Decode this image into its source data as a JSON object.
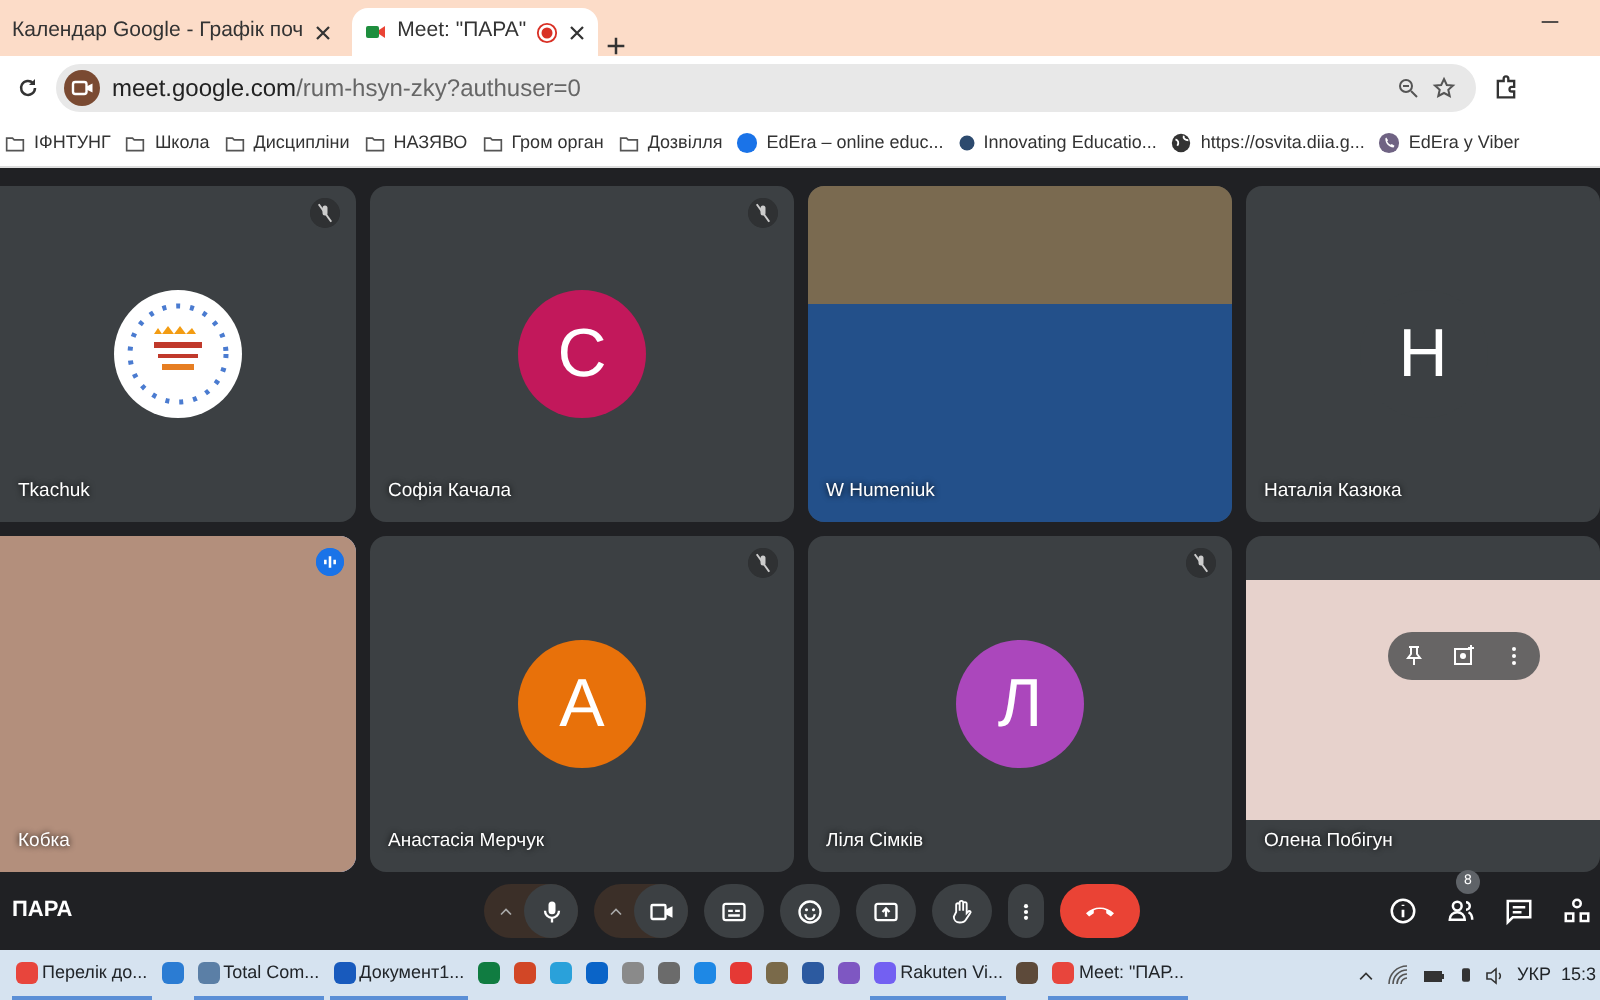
{
  "browser_tabs": [
    {
      "title": "Календар Google - Графік поч",
      "selected": false,
      "recording": false
    },
    {
      "title": "Meet: \"ПАРА\"",
      "selected": true,
      "recording": true
    }
  ],
  "address_bar": {
    "domain": "meet.google.com",
    "path": "/rum-hsyn-zky?authuser=0"
  },
  "bookmarks": [
    {
      "label": "ІФНТУНГ",
      "kind": "folder"
    },
    {
      "label": "Школа",
      "kind": "folder"
    },
    {
      "label": "Дисципліни",
      "kind": "folder"
    },
    {
      "label": "НАЗЯВО",
      "kind": "folder"
    },
    {
      "label": "Гром орган",
      "kind": "folder"
    },
    {
      "label": "Дозвілля",
      "kind": "folder"
    },
    {
      "label": "EdEra – online educ...",
      "kind": "site"
    },
    {
      "label": "Innovating Educatio...",
      "kind": "dot"
    },
    {
      "label": "https://osvita.diia.g...",
      "kind": "globe"
    },
    {
      "label": "EdEra у Viber",
      "kind": "viber"
    }
  ],
  "tiles": [
    {
      "name": "Tkachuk",
      "kind": "logo",
      "muted": true,
      "speaking": false,
      "hovered": false
    },
    {
      "name": "Софія Качала",
      "kind": "avatar",
      "initial": "С",
      "color": "#c2185b",
      "muted": true,
      "speaking": false,
      "hovered": false
    },
    {
      "name": "W Humeniuk",
      "kind": "video",
      "muted": false,
      "speaking": false,
      "hovered": false
    },
    {
      "name": "Наталія Казюка",
      "kind": "avatar",
      "initial": "Н",
      "color": "#3c4043",
      "muted": false,
      "speaking": false,
      "hovered": false
    },
    {
      "name": "Кобка",
      "kind": "video",
      "muted": false,
      "speaking": true,
      "hovered": false
    },
    {
      "name": "Анастасія Мерчук",
      "kind": "avatar",
      "initial": "А",
      "color": "#e8710a",
      "muted": true,
      "speaking": false,
      "hovered": false
    },
    {
      "name": "Ліля Сімків",
      "kind": "avatar",
      "initial": "Л",
      "color": "#ab47bc",
      "muted": true,
      "speaking": false,
      "hovered": false
    },
    {
      "name": "Олена Побігун",
      "kind": "video",
      "muted": false,
      "speaking": false,
      "hovered": true
    }
  ],
  "meeting_title": "ПАРА",
  "participants_count": "8",
  "taskbar": [
    {
      "label": "Перелік до...",
      "color": "#e8453c",
      "active": true
    },
    {
      "color": "#2b7cd3",
      "active": false
    },
    {
      "label": "Total Com...",
      "color": "#5b7fa6",
      "active": true
    },
    {
      "label": "Документ1...",
      "color": "#185abd",
      "active": true
    },
    {
      "color": "#107c41",
      "active": false
    },
    {
      "color": "#d24726",
      "active": false
    },
    {
      "color": "#2aa1da",
      "active": false
    },
    {
      "color": "#0a64c8",
      "active": false
    },
    {
      "color": "#8a8a8a",
      "active": false
    },
    {
      "color": "#6b6b6b",
      "active": false
    },
    {
      "color": "#1e88e5",
      "active": false
    },
    {
      "color": "#e53935",
      "active": false
    },
    {
      "color": "#7a6a4a",
      "active": false
    },
    {
      "color": "#2c5aa0",
      "active": false
    },
    {
      "color": "#7e57c2",
      "active": false
    },
    {
      "label": "Rakuten Vi...",
      "color": "#7360f2",
      "active": true
    },
    {
      "color": "#5d4a3a",
      "active": false
    },
    {
      "label": "Meet: \"ПАР...",
      "color": "#e8453c",
      "active": true
    }
  ],
  "tray": {
    "language": "УКР",
    "time": "15:3"
  }
}
